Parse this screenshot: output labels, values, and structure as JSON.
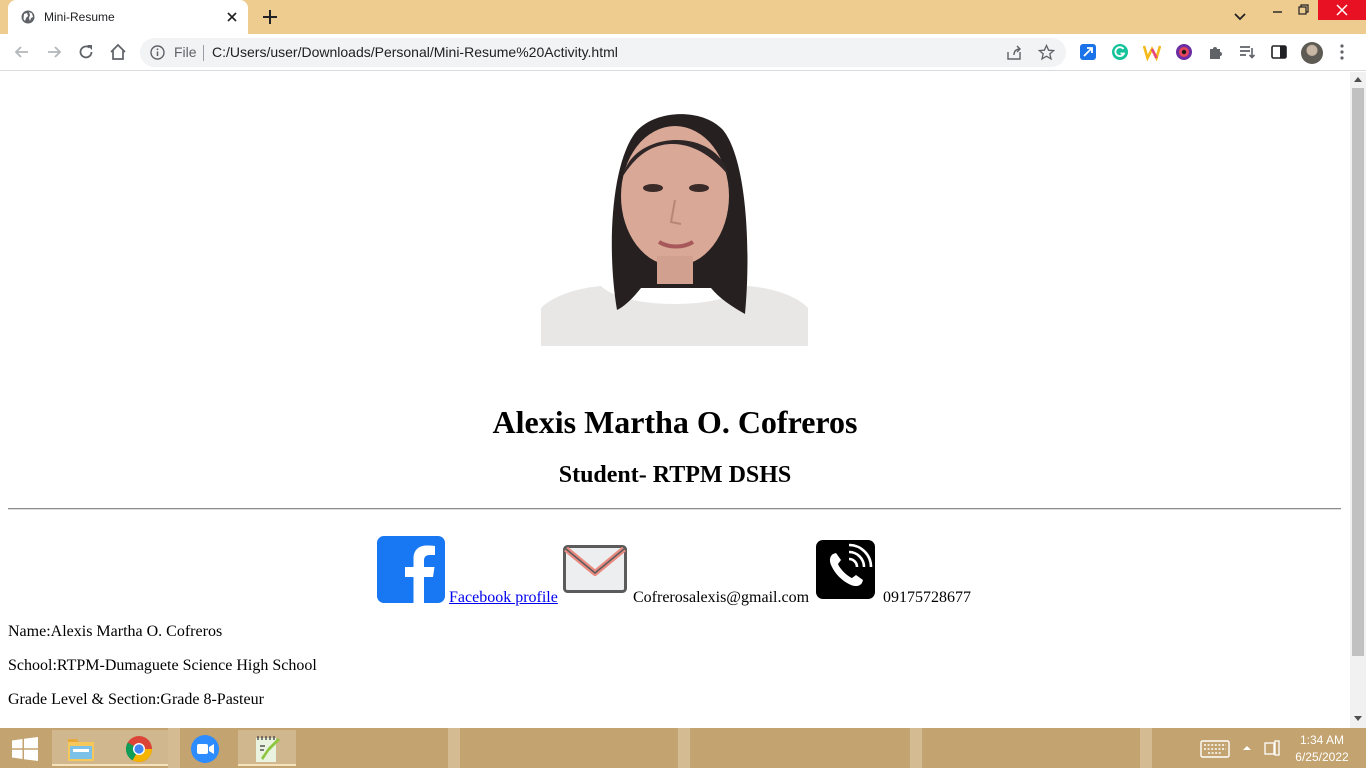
{
  "browser": {
    "tab_title": "Mini-Resume",
    "omnibox_scheme_label": "File",
    "url": "C:/Users/user/Downloads/Personal/Mini-Resume%20Activity.html"
  },
  "page": {
    "heading": "Alexis Martha O. Cofreros",
    "subheading": "Student- RTPM DSHS",
    "contacts": {
      "facebook_label": "Facebook profile",
      "email": "Cofrerosalexis@gmail.com",
      "phone": "09175728677"
    },
    "info": [
      "Name:Alexis Martha O. Cofreros",
      "School:RTPM-Dumaguete Science High School",
      "Grade Level & Section:Grade 8-Pasteur"
    ]
  },
  "taskbar": {
    "apps": [
      "file-explorer",
      "chrome",
      "zoom",
      "notepad-plus-plus"
    ],
    "clock_time": "1:34 AM",
    "clock_date": "6/25/2022"
  },
  "colors": {
    "tabstrip_bg": "#eecb8f",
    "taskbar_bg": "#c3a36f",
    "link": "#0000ee",
    "facebook_blue": "#1877f2",
    "close_red": "#e81123"
  }
}
